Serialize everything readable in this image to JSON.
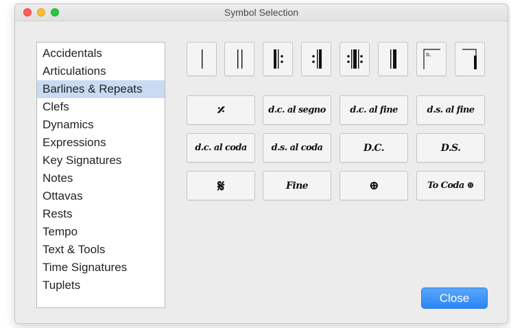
{
  "window": {
    "title": "Symbol Selection"
  },
  "categories": [
    "Accidentals",
    "Articulations",
    "Barlines & Repeats",
    "Clefs",
    "Dynamics",
    "Expressions",
    "Key Signatures",
    "Notes",
    "Ottavas",
    "Rests",
    "Tempo",
    "Text & Tools",
    "Time Signatures",
    "Tuplets"
  ],
  "selected_category": "Barlines & Repeats",
  "symbols": {
    "row1": [
      {
        "icon": "single-barline-icon"
      },
      {
        "icon": "double-barline-icon"
      },
      {
        "icon": "start-repeat-icon"
      },
      {
        "icon": "end-repeat-icon"
      },
      {
        "icon": "end-start-repeat-icon"
      },
      {
        "icon": "final-barline-icon"
      },
      {
        "icon": "first-ending-bracket-icon",
        "label": "n."
      },
      {
        "icon": "ending-bracket-close-icon"
      }
    ],
    "text_buttons": {
      "measure_repeat": "𝄎",
      "dc_al_segno": "d.c. al segno",
      "dc_al_fine": "d.c. al fine",
      "ds_al_fine": "d.s. al fine",
      "dc_al_coda": "d.c. al coda",
      "ds_al_coda": "d.s. al coda",
      "dc": "D.C.",
      "ds": "D.S.",
      "segno": "𝄋",
      "fine": "Fine",
      "coda": "⊕",
      "to_coda": "To Coda ⊕"
    }
  },
  "buttons": {
    "close": "Close"
  },
  "colors": {
    "accent": "#2b86f5",
    "selection": "#c9dbf2"
  }
}
